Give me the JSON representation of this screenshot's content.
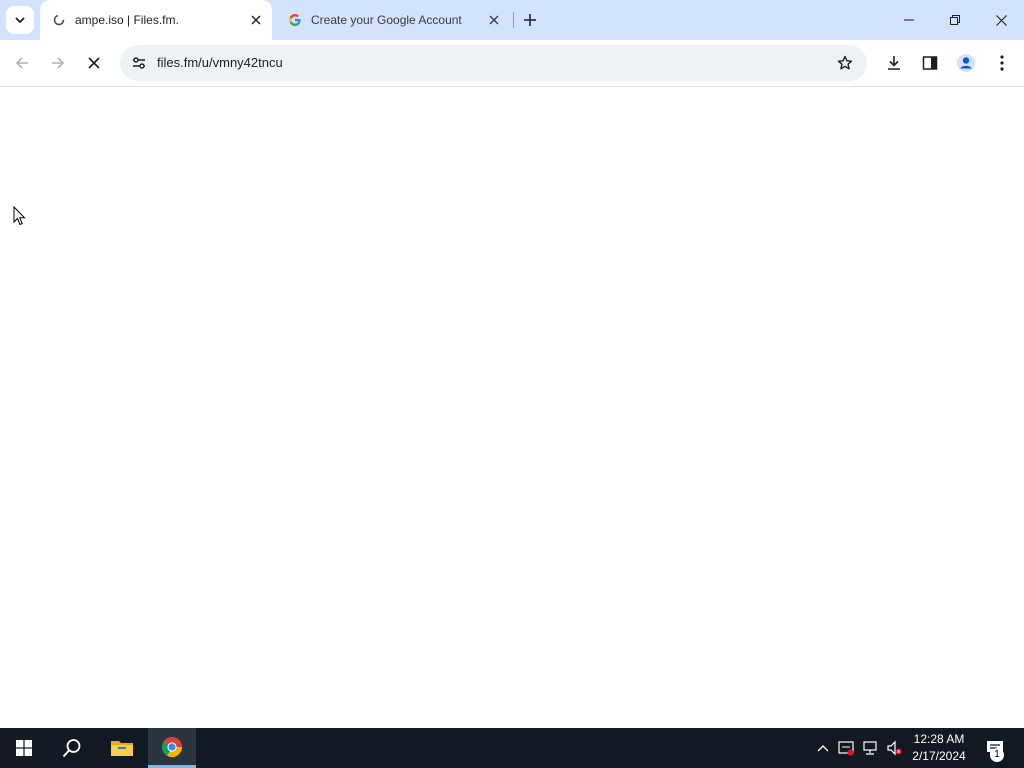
{
  "browser": {
    "tabs": [
      {
        "title": "ampe.iso | Files.fm.",
        "active": true
      },
      {
        "title": "Create your Google Account",
        "active": false
      }
    ],
    "address_bar": {
      "url": "files.fm/u/vmny42tncu"
    }
  },
  "taskbar": {
    "time": "12:28 AM",
    "date": "2/17/2024",
    "notification_count": "1"
  },
  "colors": {
    "tabstrip_bg": "#d3e3fd",
    "taskbar_bg": "#111a23",
    "accent": "#0b57d0"
  }
}
